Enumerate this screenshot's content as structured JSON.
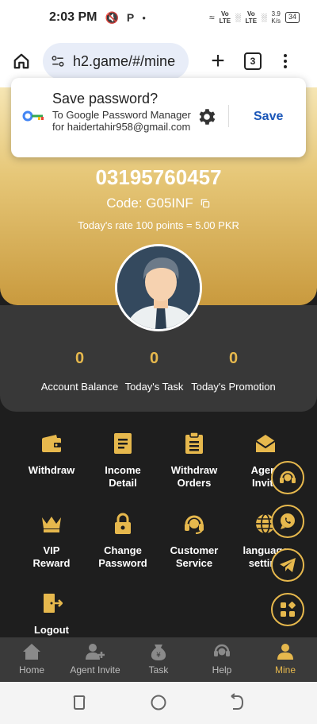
{
  "status": {
    "time": "2:03 PM",
    "network1": "Vo\nLTE",
    "network2": "Vo\nLTE",
    "speed": "3.9\nK/s",
    "battery": "34"
  },
  "browser": {
    "url": "h2.game/#/mine",
    "tab_count": "3"
  },
  "password_prompt": {
    "title": "Save password?",
    "subtitle": "To Google Password Manager for haidertahir958@gmail.com",
    "save_label": "Save"
  },
  "profile": {
    "phone": "03195760457",
    "code": "Code: G05INF",
    "rate": "Today's rate 100 points = 5.00 PKR"
  },
  "stats": [
    {
      "value": "0",
      "label": "Account Balance"
    },
    {
      "value": "0",
      "label": "Today's Task"
    },
    {
      "value": "0",
      "label": "Today's Promotion"
    }
  ],
  "menu": [
    {
      "label": "Withdraw",
      "icon": "wallet-icon"
    },
    {
      "label": "Income\nDetail",
      "icon": "document-icon"
    },
    {
      "label": "Withdraw\nOrders",
      "icon": "clipboard-icon"
    },
    {
      "label": "Agent\nInvite",
      "icon": "envelope-icon"
    },
    {
      "label": "VIP\nReward",
      "icon": "crown-icon"
    },
    {
      "label": "Change\nPassword",
      "icon": "lock-icon"
    },
    {
      "label": "Customer\nService",
      "icon": "headset-icon"
    },
    {
      "label": "language\nsetting",
      "icon": "globe-icon"
    },
    {
      "label": "Logout",
      "icon": "logout-icon"
    }
  ],
  "nav": [
    {
      "label": "Home",
      "icon": "home-icon"
    },
    {
      "label": "Agent Invite",
      "icon": "agent-icon"
    },
    {
      "label": "Task",
      "icon": "task-icon"
    },
    {
      "label": "Help",
      "icon": "help-icon"
    },
    {
      "label": "Mine",
      "icon": "mine-icon",
      "active": true
    }
  ],
  "colors": {
    "accent": "#e6b84d",
    "dark_bg": "#1e1e1e"
  }
}
